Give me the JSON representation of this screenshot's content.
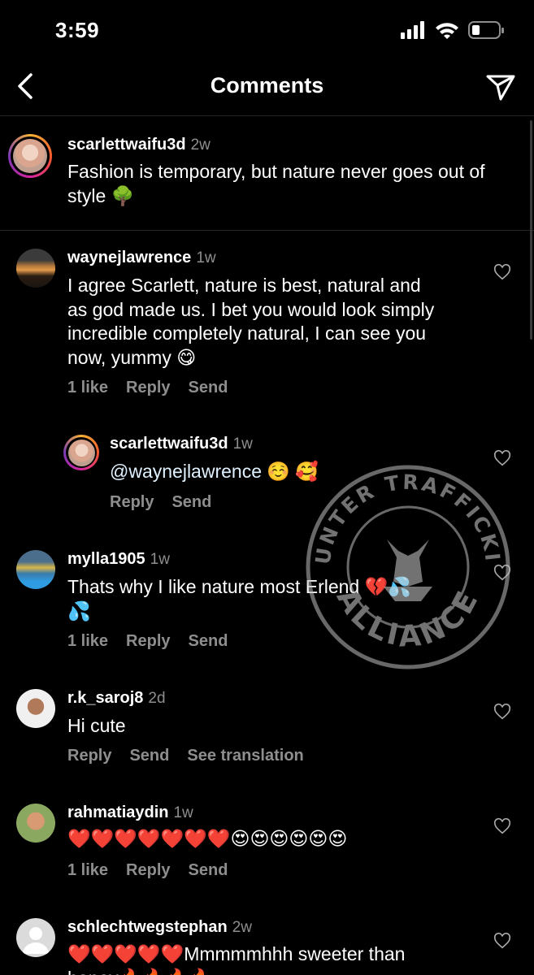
{
  "status_bar": {
    "time": "3:59"
  },
  "header": {
    "title": "Comments"
  },
  "caption": {
    "username": "scarlettwaifu3d",
    "time": "2w",
    "text": "Fashion is temporary, but nature never goes out of style 🌳"
  },
  "comments": [
    {
      "username": "waynejlawrence",
      "time": "1w",
      "lines": [
        "I agree Scarlett, nature is best, natural and",
        "as god made us. I bet you would look simply",
        "incredible completely natural, I can see you",
        "now, yummy 😋"
      ],
      "likes": "1 like",
      "reply": "Reply",
      "send": "Send"
    },
    {
      "username": "scarlettwaifu3d",
      "time": "1w",
      "mention": "@waynejlawrence",
      "emojis": " ☺️ 🥰",
      "reply": "Reply",
      "send": "Send"
    },
    {
      "username": "mylla1905",
      "time": "1w",
      "lines": [
        "Thats why I like nature most Erlend 💔💦",
        "💦"
      ],
      "likes": "1 like",
      "reply": "Reply",
      "send": "Send"
    },
    {
      "username": "r.k_saroj8",
      "time": "2d",
      "lines": [
        "Hi cute"
      ],
      "reply": "Reply",
      "send": "Send",
      "translate": "See translation"
    },
    {
      "username": "rahmatiaydin",
      "time": "1w",
      "lines": [
        "❤️❤️❤️❤️❤️❤️❤️😍😍😍😍😍😍"
      ],
      "likes": "1 like",
      "reply": "Reply",
      "send": "Send"
    },
    {
      "username": "schlechtwegstephan",
      "time": "2w",
      "lines": [
        "❤️❤️❤️❤️❤️Mmmmmhhh sweeter than",
        "honey🔥🔥🔥🔥"
      ]
    }
  ],
  "watermark": {
    "top_text": "COUNTER TRAFFICKING",
    "bottom_text": "ALLIANCE"
  },
  "colors": {
    "background": "#000000",
    "secondary_text": "#8e8e8e",
    "divider": "#262626",
    "mention": "#e0f1ff"
  }
}
